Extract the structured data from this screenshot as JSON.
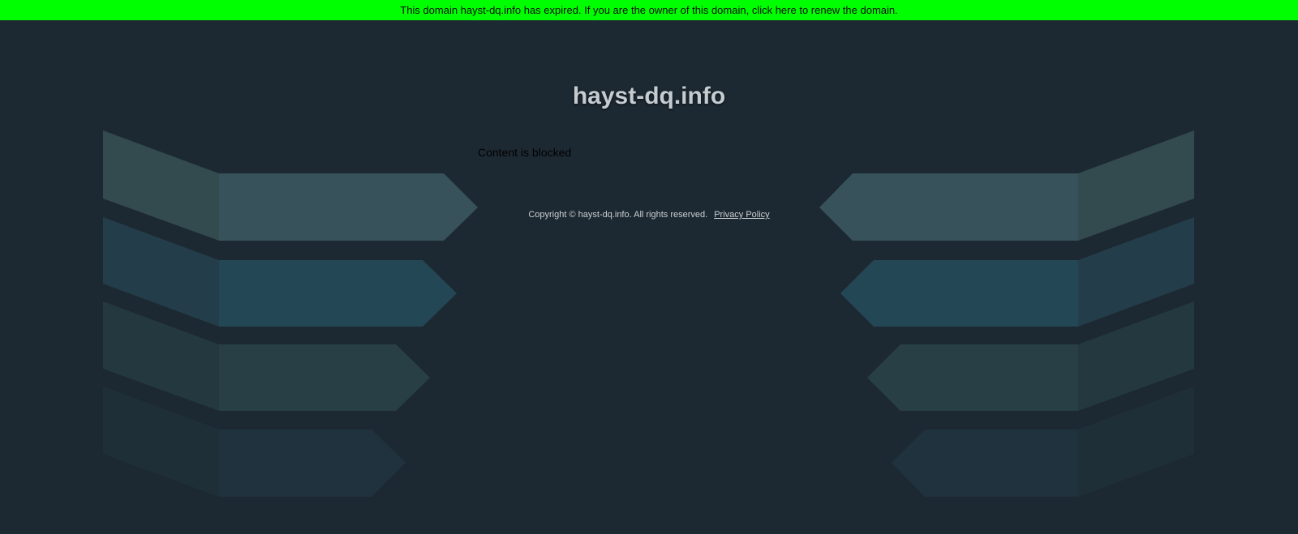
{
  "banner": {
    "text": "This domain hayst-dq.info has expired. If you are the owner of this domain, click here to renew the domain."
  },
  "site": {
    "title": "hayst-dq.info"
  },
  "content": {
    "status": "Content is blocked"
  },
  "footer": {
    "copyright": "Copyright © hayst-dq.info.  All rights reserved.",
    "privacy_label": "Privacy Policy"
  },
  "colors": {
    "background": "#1d2932",
    "banner": "#00ff00",
    "title": "#c5ccd1"
  }
}
